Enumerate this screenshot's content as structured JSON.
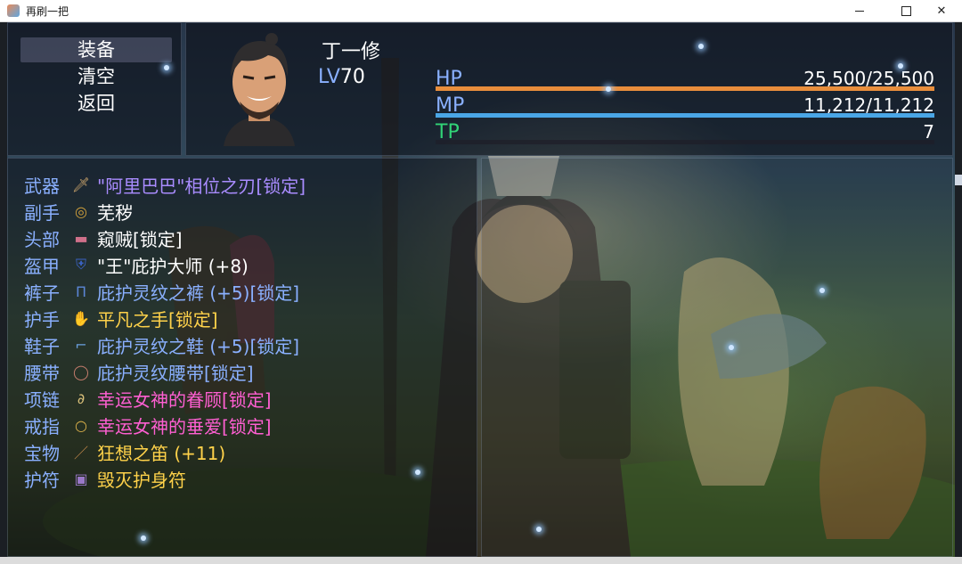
{
  "window": {
    "title": "再刷一把"
  },
  "commands": [
    {
      "label": "装备",
      "selected": true
    },
    {
      "label": "清空",
      "selected": false
    },
    {
      "label": "返回",
      "selected": false
    }
  ],
  "actor": {
    "name": "丁一修",
    "level_label": "LV",
    "level": "70",
    "gauges": [
      {
        "label": "HP",
        "value": "25,500/25,500",
        "fill": 1.0,
        "color": "#e88e3c",
        "label_color": "#8ab0ff"
      },
      {
        "label": "MP",
        "value": "11,212/11,212",
        "fill": 1.0,
        "color": "#4aa6e6",
        "label_color": "#8ab0ff"
      },
      {
        "label": "TP",
        "value": "7",
        "fill": 0.0,
        "color": "#2ec46a",
        "label_color": "#31d477"
      }
    ]
  },
  "equipment": [
    {
      "slot": "武器",
      "item": "\"阿里巴巴\"相位之刃[锁定]",
      "icon": "sword-icon",
      "color": "#a98cff"
    },
    {
      "slot": "副手",
      "item": "芜秽",
      "icon": "ring-orb-icon",
      "color": "#ffffff"
    },
    {
      "slot": "头部",
      "item": "窥贼[锁定]",
      "icon": "mask-icon",
      "color": "#ffffff"
    },
    {
      "slot": "盔甲",
      "item": "\"王\"庇护大师 (+8)",
      "icon": "armor-icon",
      "color": "#ffffff"
    },
    {
      "slot": "裤子",
      "item": "庇护灵纹之裤 (+5)[锁定]",
      "icon": "pants-icon",
      "color": "#8ab0ff"
    },
    {
      "slot": "护手",
      "item": "平凡之手[锁定]",
      "icon": "glove-icon",
      "color": "#ffd24a"
    },
    {
      "slot": "鞋子",
      "item": "庇护灵纹之鞋 (+5)[锁定]",
      "icon": "boots-icon",
      "color": "#8ab0ff"
    },
    {
      "slot": "腰带",
      "item": "庇护灵纹腰带[锁定]",
      "icon": "belt-icon",
      "color": "#8ab0ff"
    },
    {
      "slot": "项链",
      "item": "幸运女神的眷顾[锁定]",
      "icon": "necklace-icon",
      "color": "#ff5fd2"
    },
    {
      "slot": "戒指",
      "item": "幸运女神的垂爱[锁定]",
      "icon": "ring-icon",
      "color": "#ff5fd2"
    },
    {
      "slot": "宝物",
      "item": "狂想之笛 (+11)",
      "icon": "flute-icon",
      "color": "#ffd24a"
    },
    {
      "slot": "护符",
      "item": "毁灭护身符",
      "icon": "amulet-icon",
      "color": "#ffd24a"
    }
  ]
}
